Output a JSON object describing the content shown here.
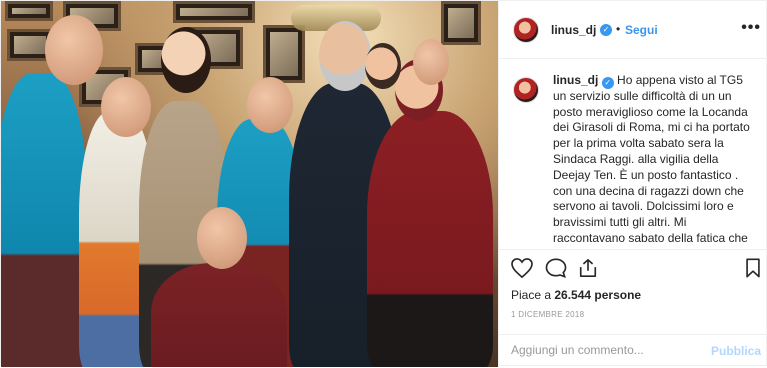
{
  "post": {
    "username": "linus_dj",
    "verified": true,
    "separator": "•",
    "follow_label": "Segui",
    "more_label": "•••",
    "caption": {
      "username": "linus_dj",
      "text": "Ho appena visto al TG5 un servizio sulle difficoltà di un un posto meraviglioso come la Locanda dei Girasoli di Roma, mi ci ha portato per la prima volta sabato sera la Sindaca Raggi. alla vigilia della Deejay Ten. È un posto fantastico . con una decina di ragazzi down che servono ai tavoli. Dolcissimi loro e bravissimi tutti gli altri. Mi raccontavano sabato della fatica che fanno a far quadrare i conti,"
    },
    "likes": {
      "prefix": "Piace a",
      "count": "26.544",
      "suffix": "persone"
    },
    "date": "1 DICEMBRE 2018",
    "comment": {
      "placeholder": "Aggiungi un commento...",
      "publish_label": "Pubblica"
    },
    "icons": {
      "like": "heart-icon",
      "comment": "comment-icon",
      "share": "share-icon",
      "save": "bookmark-icon"
    },
    "colors": {
      "link_blue": "#3897f0",
      "publish_disabled": "#b3d7fb",
      "text": "#262626",
      "muted": "#999999"
    }
  }
}
